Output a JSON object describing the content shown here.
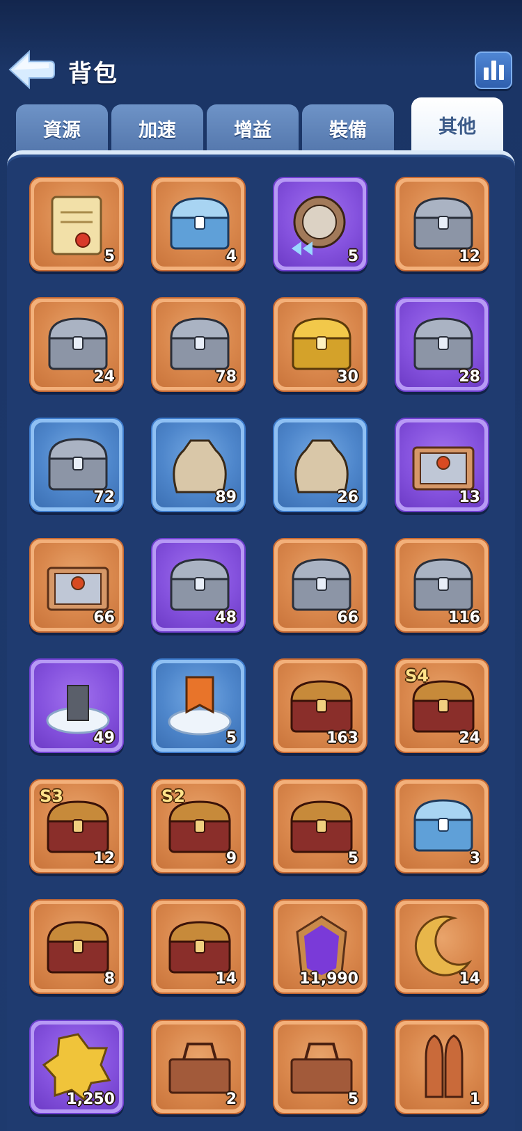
{
  "header": {
    "title": "背包"
  },
  "tabs": [
    {
      "label": "資源",
      "active": false
    },
    {
      "label": "加速",
      "active": false
    },
    {
      "label": "增益",
      "active": false
    },
    {
      "label": "裝備",
      "active": false
    },
    {
      "label": "其他",
      "active": true
    }
  ],
  "items": [
    {
      "icon": "scroll-icon",
      "quantity": "5",
      "rarity": "orange"
    },
    {
      "icon": "silver-chest-puzzle-icon",
      "quantity": "4",
      "rarity": "orange"
    },
    {
      "icon": "compass-speedup-icon",
      "quantity": "5",
      "rarity": "purple"
    },
    {
      "icon": "mystery-chest-icon",
      "quantity": "12",
      "rarity": "orange"
    },
    {
      "icon": "mystery-chest-icon",
      "quantity": "24",
      "rarity": "orange"
    },
    {
      "icon": "mystery-chest-icon",
      "quantity": "78",
      "rarity": "orange"
    },
    {
      "icon": "gold-chest-icon",
      "quantity": "30",
      "rarity": "orange"
    },
    {
      "icon": "mystery-chest-purple-icon",
      "quantity": "28",
      "rarity": "purple"
    },
    {
      "icon": "mystery-chest-icon",
      "quantity": "72",
      "rarity": "blue"
    },
    {
      "icon": "skull-sack-icon",
      "quantity": "89",
      "rarity": "blue"
    },
    {
      "icon": "supply-sack-icon",
      "quantity": "26",
      "rarity": "blue"
    },
    {
      "icon": "ornate-crate-icon",
      "quantity": "13",
      "rarity": "purple"
    },
    {
      "icon": "ornate-crate-icon",
      "quantity": "66",
      "rarity": "orange"
    },
    {
      "icon": "purple-chest-icon",
      "quantity": "48",
      "rarity": "purple"
    },
    {
      "icon": "iron-chest-icon",
      "quantity": "66",
      "rarity": "orange"
    },
    {
      "icon": "spartan-chest-icon",
      "quantity": "116",
      "rarity": "orange"
    },
    {
      "icon": "relocation-icon",
      "quantity": "49",
      "rarity": "purple"
    },
    {
      "icon": "banner-relocation-icon",
      "quantity": "5",
      "rarity": "blue"
    },
    {
      "icon": "treasure-chest-icon",
      "quantity": "163",
      "rarity": "orange"
    },
    {
      "icon": "season-treasure-icon",
      "quantity": "24",
      "rarity": "orange",
      "season": "S4"
    },
    {
      "icon": "season-treasure-icon",
      "quantity": "12",
      "rarity": "orange",
      "season": "S3"
    },
    {
      "icon": "season-treasure-icon",
      "quantity": "9",
      "rarity": "orange",
      "season": "S2"
    },
    {
      "icon": "treasure-chest-icon",
      "quantity": "5",
      "rarity": "orange"
    },
    {
      "icon": "silver-treasure-chest-icon",
      "quantity": "3",
      "rarity": "orange"
    },
    {
      "icon": "red-chest-icon",
      "quantity": "8",
      "rarity": "orange"
    },
    {
      "icon": "red-chest-icon",
      "quantity": "14",
      "rarity": "orange"
    },
    {
      "icon": "purple-rune-icon",
      "quantity": "11,990",
      "rarity": "orange"
    },
    {
      "icon": "crescent-moon-icon",
      "quantity": "14",
      "rarity": "orange"
    },
    {
      "icon": "gold-badge-mystery-icon",
      "quantity": "1,250",
      "rarity": "purple"
    },
    {
      "icon": "toolbox-potions-icon",
      "quantity": "2",
      "rarity": "orange"
    },
    {
      "icon": "toolbox-tools-icon",
      "quantity": "5",
      "rarity": "orange"
    },
    {
      "icon": "rocket-bundle-icon",
      "quantity": "1",
      "rarity": "orange"
    }
  ]
}
